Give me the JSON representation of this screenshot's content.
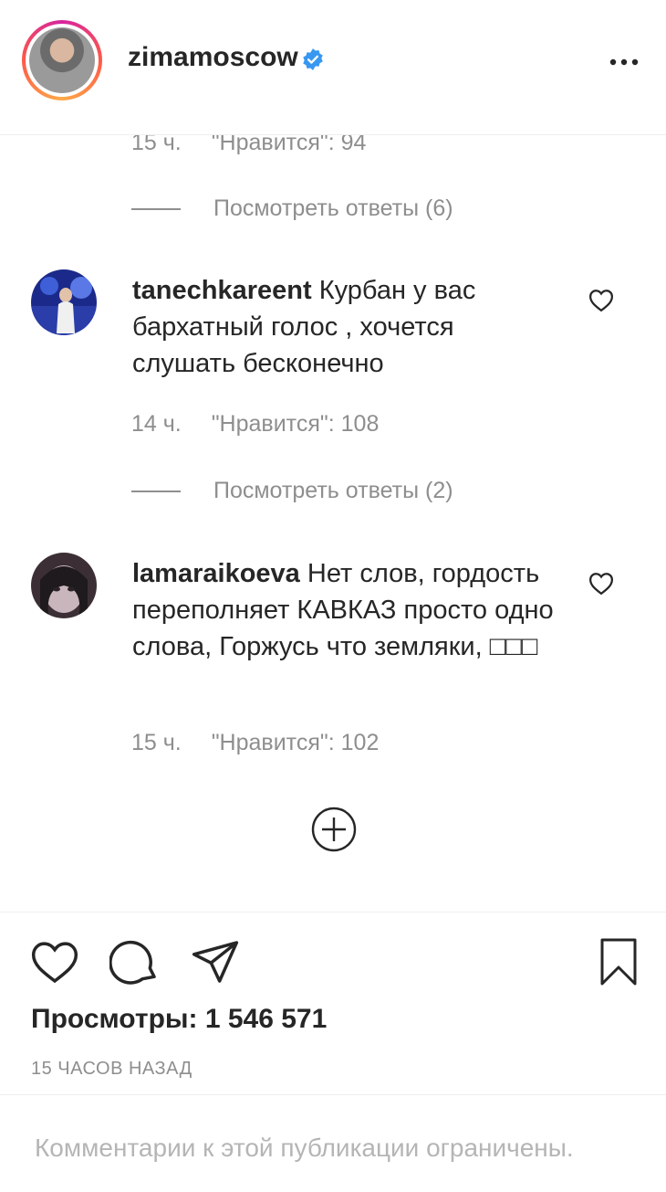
{
  "header": {
    "username": "zimamoscow",
    "verified_color": "#3897f0"
  },
  "comments": [
    {
      "partial": true,
      "time": "15 ч.",
      "likes": "\"Нравится\": 94",
      "replies": "Посмотреть ответы (6)"
    },
    {
      "username": "tanechkareent",
      "text": "Курбан у вас бархатный голос , хочется слушать бесконечно",
      "time": "14 ч.",
      "likes": "\"Нравится\": 108",
      "replies": "Посмотреть ответы (2)"
    },
    {
      "username": "lamaraikoeva",
      "text": "Нет слов, гордость переполняет КАВКАЗ просто одно слова, Горжусь что земляки, □□□",
      "time": "15 ч.",
      "likes": "\"Нравится\": 102"
    }
  ],
  "post": {
    "views": "Просмотры: 1 546 571",
    "timestamp": "15 ЧАСОВ НАЗАД"
  },
  "footer": {
    "notice": "Комментарии к этой публикации ограничены."
  },
  "icons": {
    "more": "more-options-icon",
    "like": "heart-icon",
    "comment": "comment-bubble-icon",
    "share": "paper-plane-icon",
    "save": "bookmark-icon",
    "load": "plus-circle-icon"
  }
}
